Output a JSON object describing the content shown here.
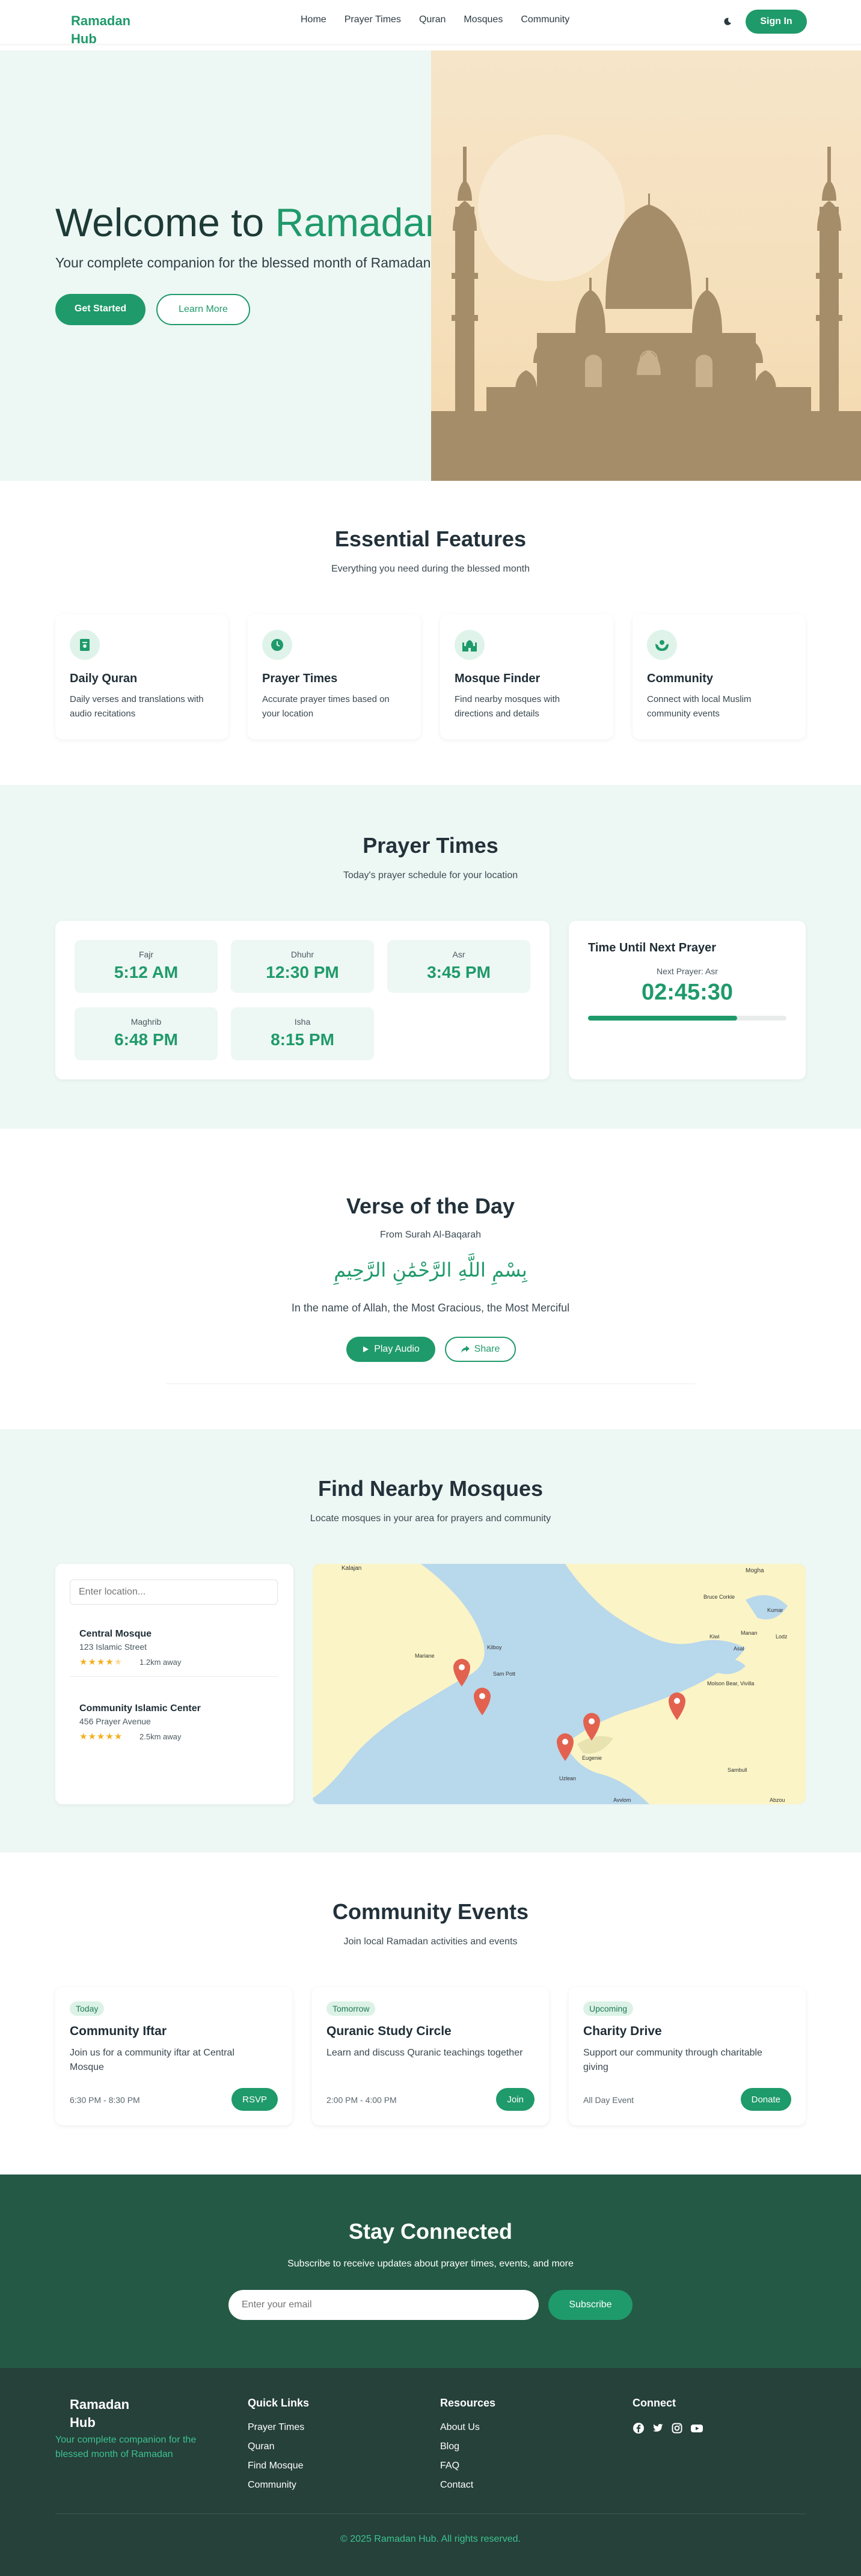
{
  "nav": {
    "brand": "Ramadan Hub",
    "links": [
      "Home",
      "Prayer Times",
      "Quran",
      "Mosques",
      "Community"
    ],
    "signin": "Sign In"
  },
  "hero": {
    "title_prefix": "Welcome to ",
    "title_accent": "Ramadan",
    "subtitle": "Your complete companion for the blessed month of Ramadan",
    "primary_button": "Get Started",
    "secondary_button": "Learn More"
  },
  "features": {
    "title": "Essential Features",
    "subtitle": "Everything you need during the blessed month",
    "items": [
      {
        "title": "Daily Quran",
        "desc": "Daily verses and translations with audio recitations",
        "icon": "book-icon"
      },
      {
        "title": "Prayer Times",
        "desc": "Accurate prayer times based on your location",
        "icon": "clock-icon"
      },
      {
        "title": "Mosque Finder",
        "desc": "Find nearby mosques with directions and details",
        "icon": "mosque-icon"
      },
      {
        "title": "Community",
        "desc": "Connect with local Muslim community events",
        "icon": "hands-icon"
      }
    ]
  },
  "prayer": {
    "title": "Prayer Times",
    "subtitle": "Today's prayer schedule for your location",
    "times": [
      {
        "name": "Fajr",
        "time": "5:12 AM"
      },
      {
        "name": "Dhuhr",
        "time": "12:30 PM"
      },
      {
        "name": "Asr",
        "time": "3:45 PM"
      },
      {
        "name": "Maghrib",
        "time": "6:48 PM"
      },
      {
        "name": "Isha",
        "time": "8:15 PM"
      }
    ],
    "next_title": "Time Until Next Prayer",
    "next_label": "Next Prayer: Asr",
    "countdown": "02:45:30",
    "progress": 0.75
  },
  "verse": {
    "title": "Verse of the Day",
    "source": "From Surah Al-Baqarah",
    "arabic": "بِسْمِ اللَّهِ الرَّحْمَٰنِ الرَّحِيمِ",
    "translation": "In the name of Allah, the Most Gracious, the Most Merciful",
    "play": "Play Audio",
    "share": "Share"
  },
  "mosques": {
    "title": "Find Nearby Mosques",
    "subtitle": "Locate mosques in your area for prayers and community",
    "search_placeholder": "Enter location...",
    "list": [
      {
        "name": "Central Mosque",
        "address": "123 Islamic Street",
        "rating": 4,
        "distance": "1.2km away"
      },
      {
        "name": "Community Islamic Center",
        "address": "456 Prayer Avenue",
        "rating": 5,
        "distance": "2.5km away"
      }
    ],
    "map_labels": [
      "Kalajan",
      "Mogha",
      "Bruce Corkle",
      "Kumar",
      "Kiwi",
      "Manan",
      "Lodz",
      "Asal",
      "Mariane",
      "Kilboy",
      "Sam Pott",
      "Molson Bear, Vivilla",
      "Eugenie",
      "Sambull",
      "Uzlean",
      "Avvlom",
      "Abzou"
    ]
  },
  "events": {
    "title": "Community Events",
    "subtitle": "Join local Ramadan activities and events",
    "items": [
      {
        "badge": "Today",
        "title": "Community Iftar",
        "desc": "Join us for a community iftar at Central Mosque",
        "time": "6:30 PM - 8:30 PM",
        "button": "RSVP"
      },
      {
        "badge": "Tomorrow",
        "title": "Quranic Study Circle",
        "desc": "Learn and discuss Quranic teachings together",
        "time": "2:00 PM - 4:00 PM",
        "button": "Join"
      },
      {
        "badge": "Upcoming",
        "title": "Charity Drive",
        "desc": "Support our community through charitable giving",
        "time": "All Day Event",
        "button": "Donate"
      }
    ]
  },
  "stay": {
    "title": "Stay Connected",
    "subtitle": "Subscribe to receive updates about prayer times, events, and more",
    "email_placeholder": "Enter your email",
    "button": "Subscribe"
  },
  "footer": {
    "brand": "Ramadan Hub",
    "tagline": "Your complete companion for the blessed month of Ramadan",
    "quick_title": "Quick Links",
    "quick_links": [
      "Prayer Times",
      "Quran",
      "Find Mosque",
      "Community"
    ],
    "resources_title": "Resources",
    "resources": [
      "About Us",
      "Blog",
      "FAQ",
      "Contact"
    ],
    "connect_title": "Connect",
    "copyright": "© 2025 Ramadan Hub. All rights reserved."
  },
  "colors": {
    "primary": "#1f9a6b",
    "mint": "#edf7f3",
    "dark_green": "#245945",
    "footer": "#26403a",
    "sand": "#f5dfbb"
  }
}
